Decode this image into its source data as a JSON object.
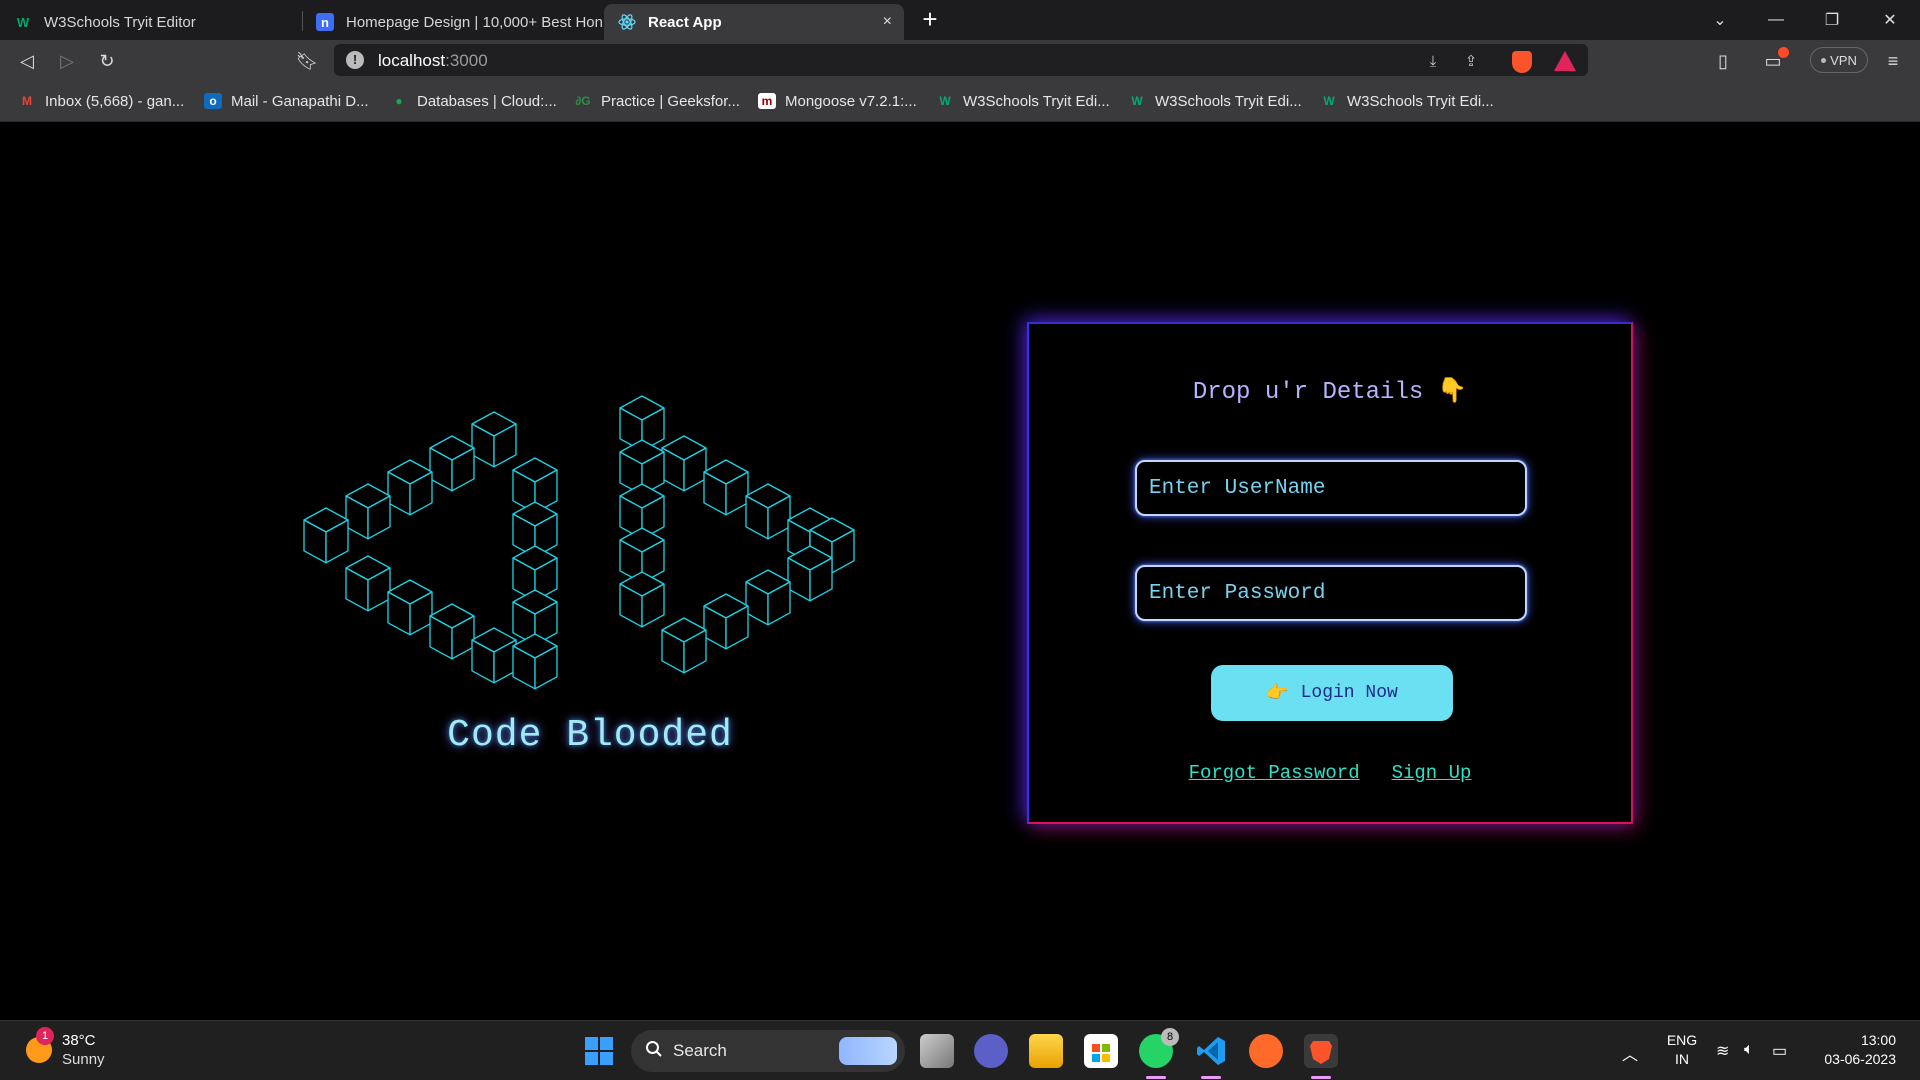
{
  "browser": {
    "tabs": [
      {
        "title": "W3Schools Tryit Editor",
        "icon": "w3schools-icon"
      },
      {
        "title": "Homepage Design | 10,000+ Best Hon",
        "icon": "n-icon"
      },
      {
        "title": "React App",
        "icon": "react-icon",
        "active": true
      }
    ],
    "tab_close": "×",
    "new_tab": "+",
    "url_host": "localhost",
    "url_port": ":3000",
    "vpn_label": "VPN",
    "bookmarks": [
      {
        "label": "Inbox (5,668) - gan...",
        "icon": "gmail-icon"
      },
      {
        "label": "Mail - Ganapathi D...",
        "icon": "outlook-icon"
      },
      {
        "label": "Databases | Cloud:...",
        "icon": "mongodb-icon"
      },
      {
        "label": "Practice | Geeksfor...",
        "icon": "gfg-icon"
      },
      {
        "label": "Mongoose v7.2.1:...",
        "icon": "mongoose-icon"
      },
      {
        "label": "W3Schools Tryit Edi...",
        "icon": "w3schools-icon"
      },
      {
        "label": "W3Schools Tryit Edi...",
        "icon": "w3schools-icon"
      },
      {
        "label": "W3Schools Tryit Edi...",
        "icon": "w3schools-icon"
      }
    ]
  },
  "page": {
    "brand_name": "Code Blooded",
    "login": {
      "title": "Drop u'r Details",
      "title_emoji": "👇",
      "username_placeholder": "Enter UserName",
      "password_placeholder": "Enter Password",
      "button_emoji": "👉",
      "button_label": "Login Now",
      "forgot_label": "Forgot Password",
      "signup_label": "Sign Up"
    },
    "colors": {
      "logo_stroke": "#19d6e8",
      "button_bg": "#6be0f2",
      "link": "#2ee0c6"
    }
  },
  "taskbar": {
    "weather_temp": "38°C",
    "weather_condition": "Sunny",
    "weather_badge": "1",
    "search_label": "Search",
    "whatsapp_badge": "8",
    "language": "ENG",
    "region": "IN",
    "time": "13:00",
    "date": "03-06-2023"
  }
}
